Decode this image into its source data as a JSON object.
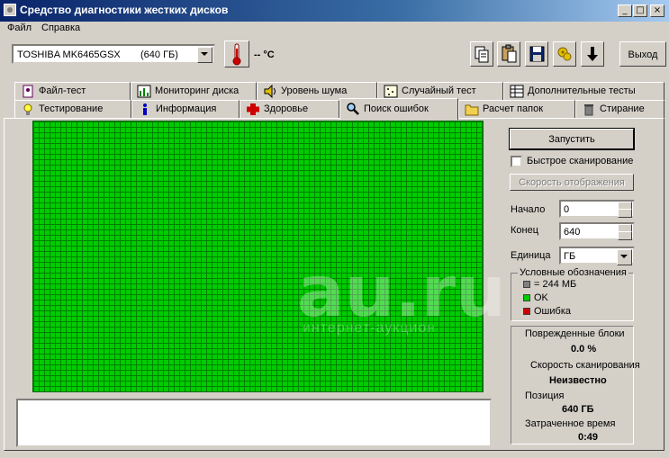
{
  "window": {
    "title": "Средство диагностики жестких дисков",
    "min": "_",
    "max": "□",
    "close": "×"
  },
  "menu": {
    "file": "Файл",
    "help": "Справка"
  },
  "toolbar": {
    "drive_name": "TOSHIBA MK6465GSX",
    "drive_size": "(640 ГБ)",
    "temperature": "-- °C",
    "exit_label": "Выход"
  },
  "tabs": {
    "row1": [
      "Файл-тест",
      "Мониторинг диска",
      "Уровень шума",
      "Случайный тест",
      "Дополнительные тесты"
    ],
    "row2": [
      "Тестирование",
      "Информация",
      "Здоровье",
      "Поиск ошибок",
      "Расчет папок",
      "Стирание"
    ],
    "active": "Поиск ошибок"
  },
  "controls": {
    "start_label": "Запустить",
    "quick_scan_label": "Быстрое сканирование",
    "quick_scan_checked": false,
    "display_speed_label": "Скорость отображения",
    "start_field_label": "Начало",
    "start_value": "0",
    "end_field_label": "Конец",
    "end_value": "640",
    "unit_field_label": "Единица",
    "unit_value": "ГБ"
  },
  "legend": {
    "title": "Условные обозначения",
    "items": [
      {
        "color": "#808080",
        "label": "= 244 МБ"
      },
      {
        "color": "#00cc00",
        "label": "OK"
      },
      {
        "color": "#cc0000",
        "label": "Ошибка"
      }
    ]
  },
  "stats": {
    "damaged_label": "Поврежденные блоки",
    "damaged_value": "0.0 %",
    "speed_label": "Скорость сканирования",
    "speed_value": "Неизвестно",
    "position_label": "Позиция",
    "position_value": "640 ГБ",
    "elapsed_label": "Затраченное время",
    "elapsed_value": "0:49"
  },
  "watermark": {
    "main": "au.ru",
    "sub": "интернет-аукцион"
  },
  "colors": {
    "ok": "#00cc00",
    "grid_line": "#008000",
    "title_bar": "#0a246a"
  }
}
